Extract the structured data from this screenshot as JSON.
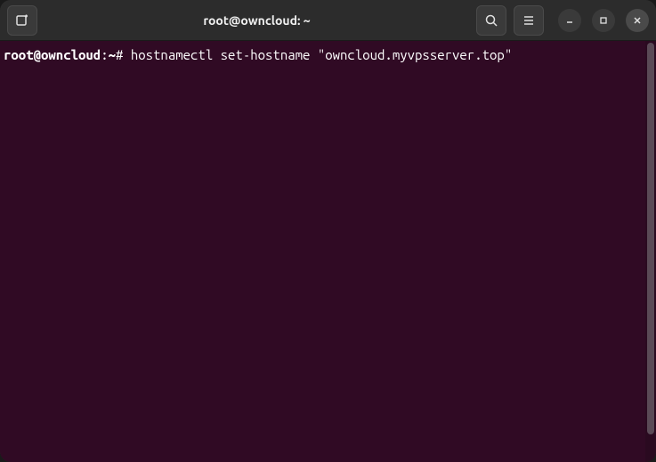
{
  "titlebar": {
    "title": "root@owncloud: ~"
  },
  "terminal": {
    "prompt_user": "root@owncloud",
    "prompt_separator": ":",
    "prompt_path": "~",
    "prompt_symbol": "# ",
    "command": "hostnamectl set-hostname \"owncloud.myvpsserver.top\""
  },
  "icons": {
    "new_tab": "new-tab-icon",
    "search": "search-icon",
    "menu": "menu-icon",
    "minimize": "minimize-icon",
    "maximize": "maximize-icon",
    "close": "close-icon"
  }
}
